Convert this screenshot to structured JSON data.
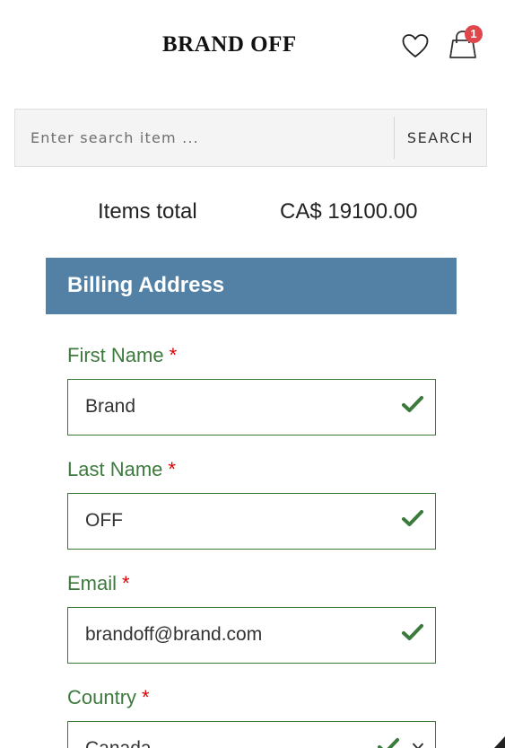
{
  "header": {
    "logo": "BRAND OFF",
    "cart_count": "1",
    "icons": {
      "wishlist": "heart-icon",
      "cart": "shopping-bag-icon"
    }
  },
  "search": {
    "placeholder": "Enter search item ...",
    "button_label": "SEARCH"
  },
  "totals": {
    "label": "Items total",
    "value": "CA$ 19100.00"
  },
  "billing": {
    "title": "Billing Address",
    "required_mark": "*",
    "fields": [
      {
        "label": "First Name",
        "value": "Brand"
      },
      {
        "label": "Last Name",
        "value": "OFF"
      },
      {
        "label": "Email",
        "value": "brandoff@brand.com"
      },
      {
        "label": "Country",
        "value": "Canada"
      }
    ]
  },
  "colors": {
    "accent": "#5381a5",
    "valid_green": "#3a7a3a",
    "required_red": "#e00000",
    "badge_red": "#e0474c"
  }
}
